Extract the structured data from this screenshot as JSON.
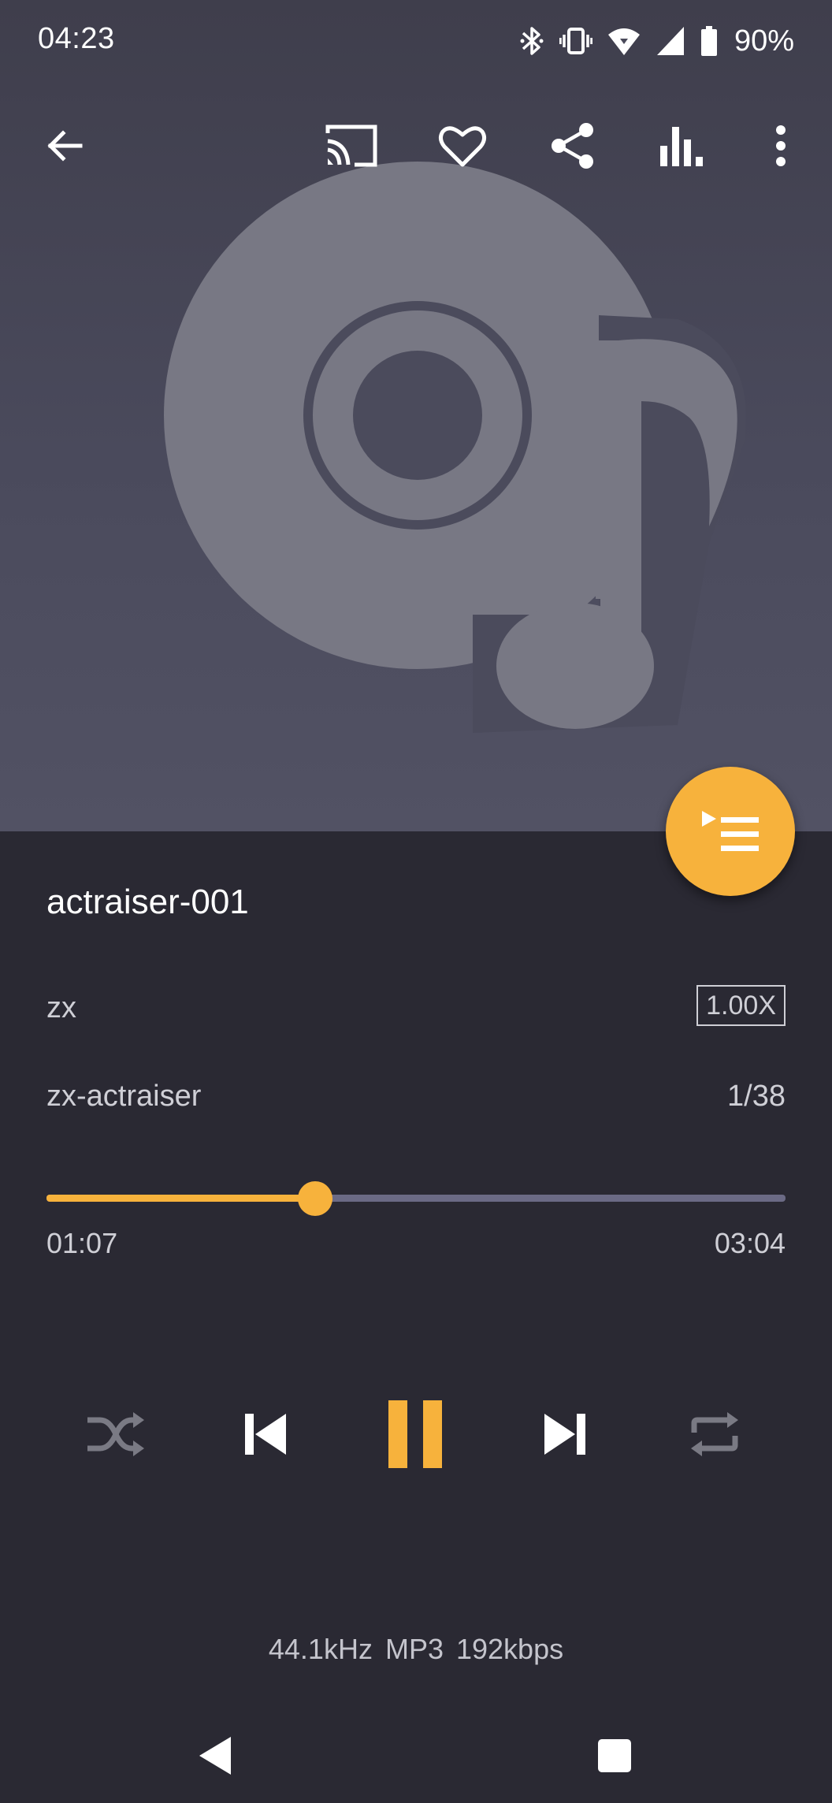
{
  "status_bar": {
    "time": "04:23",
    "battery_percent": "90%",
    "icons": [
      "bluetooth-icon",
      "vibrate-icon",
      "wifi-icon",
      "cellular-signal-icon",
      "battery-icon"
    ]
  },
  "toolbar": {
    "icons": [
      "back-arrow-icon",
      "cast-icon",
      "favorite-heart-icon",
      "share-icon",
      "equalizer-icon",
      "more-vert-icon"
    ]
  },
  "album_art": {
    "icon": "disc-music-note-icon"
  },
  "queue_fab": {
    "icon": "playlist-play-icon",
    "color": "#f7b23c"
  },
  "track": {
    "title": "actraiser-001",
    "artist": "zx",
    "album": "zx-actraiser",
    "position_in_queue": "1/38",
    "playback_speed": "1.00X"
  },
  "progress": {
    "elapsed": "01:07",
    "duration": "03:04",
    "fraction": 0.364
  },
  "controls": {
    "icons": [
      "shuffle-icon",
      "skip-previous-icon",
      "pause-icon",
      "skip-next-icon",
      "repeat-icon"
    ],
    "accent": "#f7b23c",
    "inactive": "#7a7a84"
  },
  "audio_info": "44.1kHz  MP3  192kbps",
  "nav_bar": {
    "icons": [
      "back-triangle-icon",
      "recents-square-icon"
    ]
  }
}
